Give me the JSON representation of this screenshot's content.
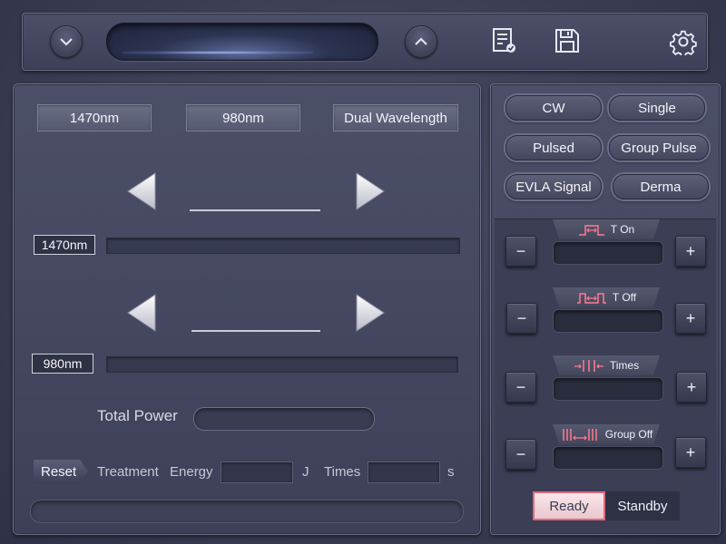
{
  "top_bar": {
    "icons": [
      "chevron-down-icon",
      "chevron-up-icon",
      "report-icon",
      "save-icon",
      "gear-icon"
    ]
  },
  "wavelength_tabs": {
    "tab1": "1470nm",
    "tab2": "980nm",
    "tab3": "Dual Wavelength"
  },
  "channels": [
    {
      "label": "1470nm"
    },
    {
      "label": "980nm"
    }
  ],
  "total_power": {
    "label": "Total Power"
  },
  "footer": {
    "reset": "Reset",
    "treatment": "Treatment",
    "energy": "Energy",
    "energy_unit": "J",
    "times": "Times",
    "times_unit": "s"
  },
  "modes": {
    "cw": "CW",
    "single": "Single",
    "pulsed": "Pulsed",
    "group_pulse": "Group Pulse",
    "evla": "EVLA  Signal",
    "derma": "Derma"
  },
  "params": [
    {
      "label": "T  On",
      "icon": "pulse-on-icon"
    },
    {
      "label": "T  Off",
      "icon": "pulse-off-icon"
    },
    {
      "label": "Times",
      "icon": "pulse-times-icon"
    },
    {
      "label": "Group  Off",
      "icon": "group-off-icon"
    }
  ],
  "controls": {
    "minus": "−",
    "plus": "+",
    "ready": "Ready",
    "standby": "Standby"
  },
  "colors": {
    "accent": "#e06a7e",
    "background": "#3a3d52"
  }
}
